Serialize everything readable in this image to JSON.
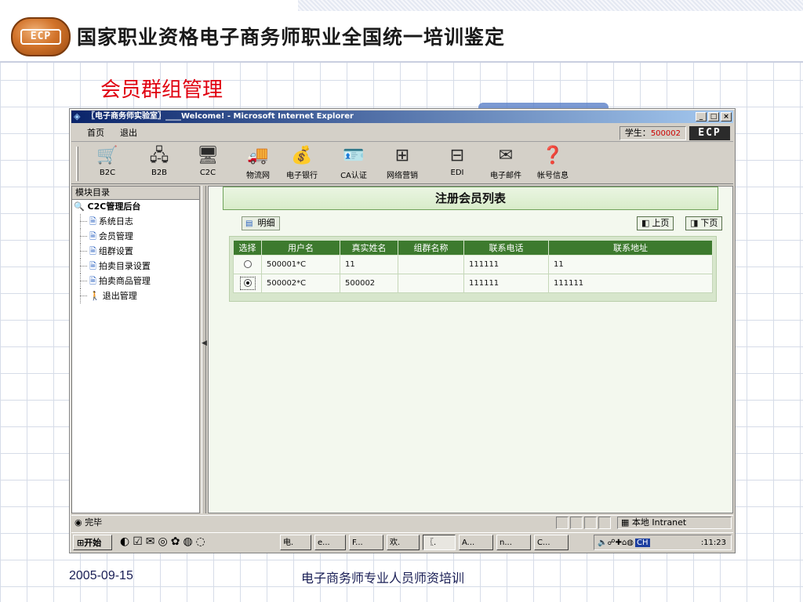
{
  "slide": {
    "logo_text": "ECP",
    "title": "国家职业资格电子商务师职业全国统一培训鉴定",
    "section_title": "会员群组管理",
    "footer_date": "2005-09-15",
    "footer_title": "电子商务师专业人员师资培训"
  },
  "browser": {
    "window_title": "〖电子商务师实验室〗____Welcome! - Microsoft Internet Explorer",
    "window_buttons": [
      "_",
      "□",
      "×"
    ],
    "menu": {
      "home": "首页",
      "logout": "退出"
    },
    "student_label": "学生：",
    "student_id": "500002",
    "brand_tag": "ECP",
    "toolbar": [
      {
        "label": "B2C",
        "icon": "shopping-cart-icon",
        "glyph": "🛒"
      },
      {
        "label": "B2B",
        "icon": "network-computers-icon",
        "glyph": "🖧"
      },
      {
        "label": "C2C",
        "icon": "desktop-computer-icon",
        "glyph": "🖥"
      },
      {
        "label": "物流网",
        "icon": "delivery-truck-icon",
        "glyph": "🚚"
      },
      {
        "label": "电子银行",
        "icon": "money-safe-icon",
        "glyph": "💰"
      },
      {
        "label": "CA认证",
        "icon": "certificate-card-icon",
        "glyph": "🪪"
      },
      {
        "label": "网络营销",
        "icon": "network-tree-icon",
        "glyph": "⊞"
      },
      {
        "label": "EDI",
        "icon": "edi-tree-icon",
        "glyph": "⊟"
      },
      {
        "label": "电子邮件",
        "icon": "email-envelope-icon",
        "glyph": "✉"
      },
      {
        "label": "帐号信息",
        "icon": "help-account-icon",
        "glyph": "❓"
      }
    ],
    "sidebar": {
      "header": "模块目录",
      "root": "C2C管理后台",
      "items": [
        "系统日志",
        "会员管理",
        "组群设置",
        "拍卖目录设置",
        "拍卖商品管理",
        "退出管理"
      ]
    },
    "content": {
      "list_title": "注册会员列表",
      "detail_button": "明细",
      "prev_page": "上页",
      "next_page": "下页",
      "columns": [
        "选择",
        "用户名",
        "真实姓名",
        "组群名称",
        "联系电话",
        "联系地址"
      ],
      "rows": [
        {
          "selected": false,
          "username": "500001*C",
          "real_name": "11",
          "group_name": "",
          "phone": "111111",
          "address": "11"
        },
        {
          "selected": true,
          "username": "500002*C",
          "real_name": "500002",
          "group_name": "",
          "phone": "111111",
          "address": "111111"
        }
      ]
    },
    "status": {
      "text": "完毕",
      "zone": "本地 Intranet"
    },
    "taskbar": {
      "start": "开始",
      "buttons": [
        "电.",
        "e...",
        "F...",
        "欢.",
        "〖.",
        "A...",
        "n...",
        "C..."
      ],
      "ime": "CH",
      "clock": ":11:23"
    }
  }
}
